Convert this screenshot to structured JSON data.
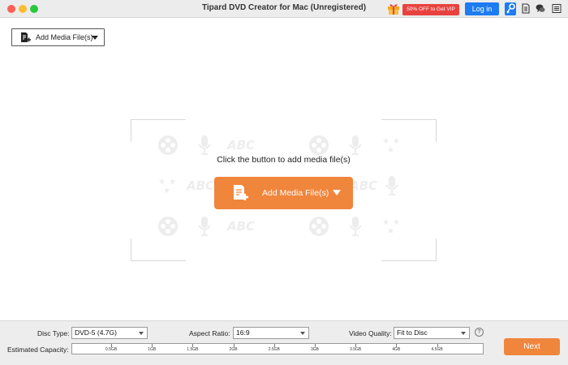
{
  "window": {
    "title": "Tipard DVD Creator for Mac (Unregistered)",
    "vip_label": "50% OFF to Get VIP",
    "login_label": "Log in"
  },
  "toolbar": {
    "add_media_label": "Add Media File(s)"
  },
  "drop_zone": {
    "prompt": "Click the button to add media file(s)",
    "add_media_label": "Add Media File(s)",
    "watermark_text": "ABC"
  },
  "bottom": {
    "disc_type_label": "Disc Type:",
    "disc_type_value": "DVD-5 (4.7G)",
    "aspect_label": "Aspect Ratio:",
    "aspect_value": "16:9",
    "quality_label": "Video Quality:",
    "quality_value": "Fit to Disc",
    "help_symbol": "?",
    "capacity_label": "Estimated Capacity:",
    "capacity_ticks": [
      "0.5GB",
      "1GB",
      "1.5GB",
      "2GB",
      "2.5GB",
      "3GB",
      "3.5GB",
      "4GB",
      "4.5GB"
    ],
    "next_label": "Next"
  },
  "icons": {
    "gift": "gift-icon",
    "key": "key-icon",
    "doc": "document-icon",
    "chat": "chat-icon",
    "menu": "menu-icon",
    "add_file": "add-file-icon",
    "help": "help-icon"
  },
  "colors": {
    "accent_orange": "#f0853c",
    "login_blue": "#1d7cf2",
    "vip_red": "#e8423f",
    "titlebar": "#ececec"
  }
}
